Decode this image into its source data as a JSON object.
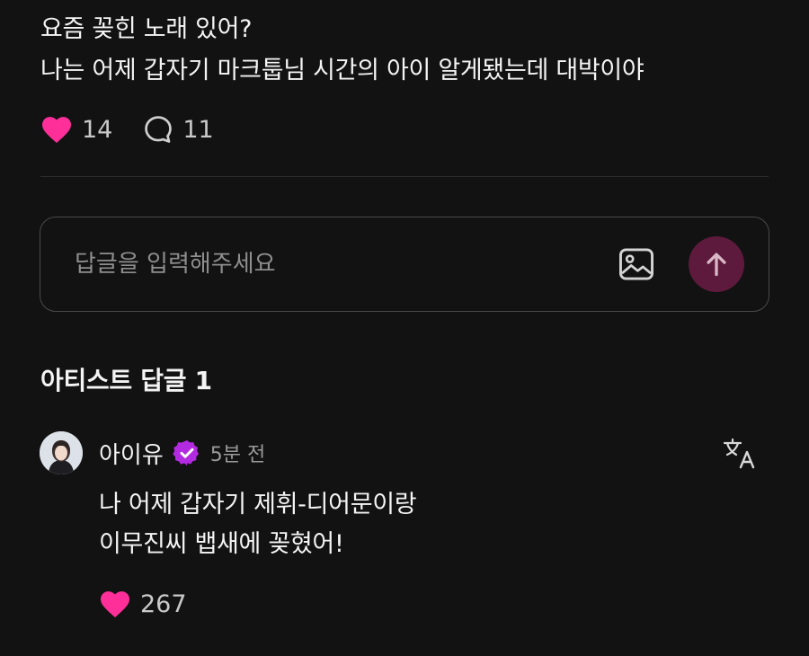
{
  "post": {
    "lines": [
      "요즘 꽂힌 노래 있어?",
      "나는 어제 갑자기 마크툽님 시간의 아이 알게됐는데 대박이야"
    ],
    "likes": "14",
    "comments": "11"
  },
  "reply_box": {
    "placeholder": "답글을 입력해주세요",
    "image_icon": "image-icon",
    "send_icon": "arrow-up-icon"
  },
  "artist_replies": {
    "title": "아티스트 답글 1",
    "items": [
      {
        "name": "아이유",
        "time": "5분 전",
        "lines": [
          "나 어제 갑자기 제휘-디어문이랑",
          "이무진씨 뱁새에 꽂혔어!"
        ],
        "likes": "267"
      }
    ]
  },
  "colors": {
    "background": "#121212",
    "heart": "#ff2f9a",
    "verified": "#b32be0",
    "send_button": "#5e1a3c"
  }
}
